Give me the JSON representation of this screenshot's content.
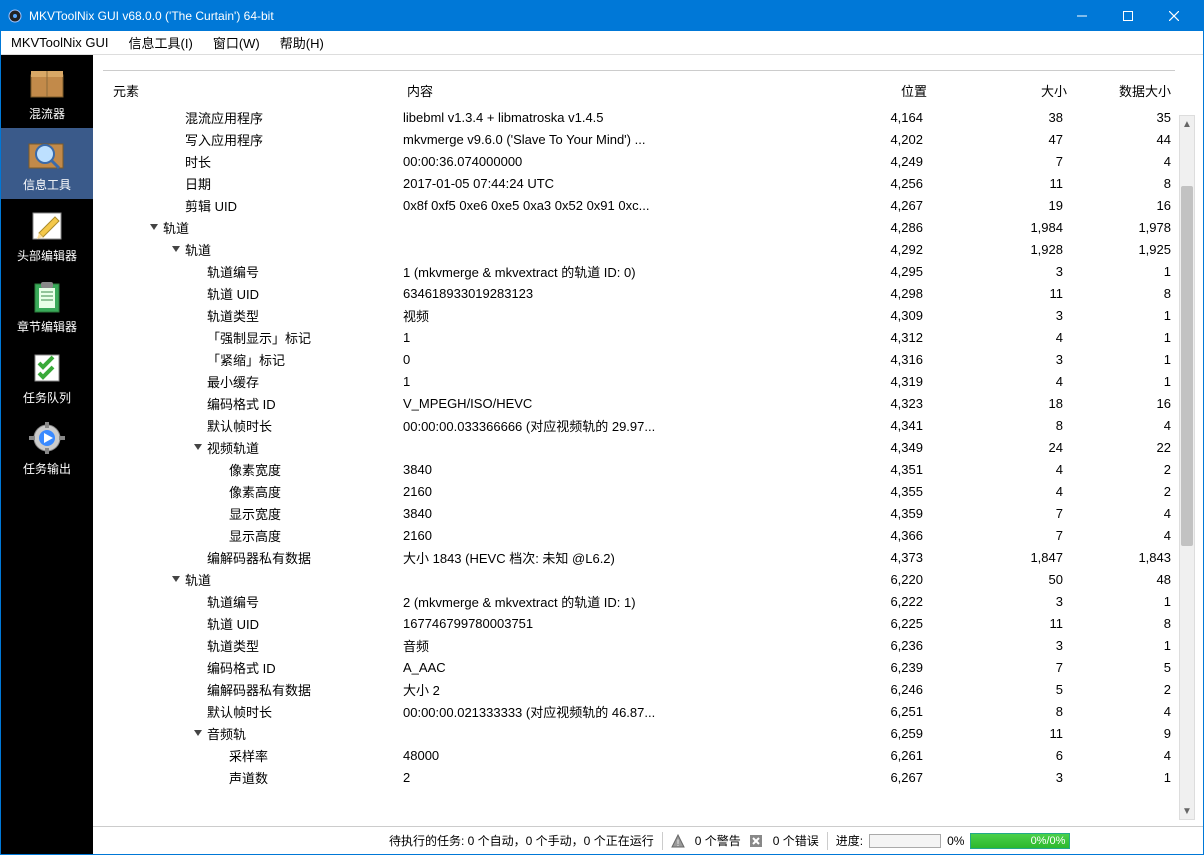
{
  "window": {
    "title": "MKVToolNix GUI v68.0.0 ('The Curtain') 64-bit"
  },
  "menubar": {
    "items": [
      "MKVToolNix GUI",
      "信息工具(I)",
      "窗口(W)",
      "帮助(H)"
    ]
  },
  "sidebar": {
    "items": [
      {
        "label": "混流器",
        "icon": "box"
      },
      {
        "label": "信息工具",
        "icon": "magnifier",
        "active": true
      },
      {
        "label": "头部编辑器",
        "icon": "pencil"
      },
      {
        "label": "章节编辑器",
        "icon": "clipboard"
      },
      {
        "label": "任务队列",
        "icon": "checklist"
      },
      {
        "label": "任务输出",
        "icon": "gearplay"
      }
    ]
  },
  "columns": {
    "c1": "元素",
    "c2": "内容",
    "c3": "位置",
    "c4": "大小",
    "c5": "数据大小"
  },
  "rows": [
    {
      "indent": 3,
      "exp": "",
      "c1": "混流应用程序",
      "c2": "libebml v1.3.4 + libmatroska v1.4.5",
      "c3": "4,164",
      "c4": "38",
      "c5": "35"
    },
    {
      "indent": 3,
      "exp": "",
      "c1": "写入应用程序",
      "c2": "mkvmerge v9.6.0 ('Slave To Your Mind') ...",
      "c3": "4,202",
      "c4": "47",
      "c5": "44"
    },
    {
      "indent": 3,
      "exp": "",
      "c1": "时长",
      "c2": "00:00:36.074000000",
      "c3": "4,249",
      "c4": "7",
      "c5": "4"
    },
    {
      "indent": 3,
      "exp": "",
      "c1": "日期",
      "c2": "2017-01-05 07:44:24 UTC",
      "c3": "4,256",
      "c4": "11",
      "c5": "8"
    },
    {
      "indent": 3,
      "exp": "",
      "c1": "剪辑 UID",
      "c2": "0x8f 0xf5 0xe6 0xe5 0xa3 0x52 0x91 0xc...",
      "c3": "4,267",
      "c4": "19",
      "c5": "16"
    },
    {
      "indent": 2,
      "exp": "open",
      "c1": "轨道",
      "c2": "",
      "c3": "4,286",
      "c4": "1,984",
      "c5": "1,978"
    },
    {
      "indent": 3,
      "exp": "open",
      "c1": "轨道",
      "c2": "",
      "c3": "4,292",
      "c4": "1,928",
      "c5": "1,925"
    },
    {
      "indent": 4,
      "exp": "",
      "c1": "轨道编号",
      "c2": "1 (mkvmerge & mkvextract 的轨道 ID: 0)",
      "c3": "4,295",
      "c4": "3",
      "c5": "1"
    },
    {
      "indent": 4,
      "exp": "",
      "c1": "轨道 UID",
      "c2": "634618933019283123",
      "c3": "4,298",
      "c4": "11",
      "c5": "8"
    },
    {
      "indent": 4,
      "exp": "",
      "c1": "轨道类型",
      "c2": "视频",
      "c3": "4,309",
      "c4": "3",
      "c5": "1"
    },
    {
      "indent": 4,
      "exp": "",
      "c1": "「强制显示」标记",
      "c2": "1",
      "c3": "4,312",
      "c4": "4",
      "c5": "1"
    },
    {
      "indent": 4,
      "exp": "",
      "c1": "「紧缩」标记",
      "c2": "0",
      "c3": "4,316",
      "c4": "3",
      "c5": "1"
    },
    {
      "indent": 4,
      "exp": "",
      "c1": "最小缓存",
      "c2": "1",
      "c3": "4,319",
      "c4": "4",
      "c5": "1"
    },
    {
      "indent": 4,
      "exp": "",
      "c1": "编码格式 ID",
      "c2": "V_MPEGH/ISO/HEVC",
      "c3": "4,323",
      "c4": "18",
      "c5": "16"
    },
    {
      "indent": 4,
      "exp": "",
      "c1": "默认帧时长",
      "c2": "00:00:00.033366666 (对应视频轨的 29.97...",
      "c3": "4,341",
      "c4": "8",
      "c5": "4"
    },
    {
      "indent": 4,
      "exp": "open",
      "c1": "视频轨道",
      "c2": "",
      "c3": "4,349",
      "c4": "24",
      "c5": "22"
    },
    {
      "indent": 5,
      "exp": "",
      "c1": "像素宽度",
      "c2": "3840",
      "c3": "4,351",
      "c4": "4",
      "c5": "2"
    },
    {
      "indent": 5,
      "exp": "",
      "c1": "像素高度",
      "c2": "2160",
      "c3": "4,355",
      "c4": "4",
      "c5": "2"
    },
    {
      "indent": 5,
      "exp": "",
      "c1": "显示宽度",
      "c2": "3840",
      "c3": "4,359",
      "c4": "7",
      "c5": "4"
    },
    {
      "indent": 5,
      "exp": "",
      "c1": "显示高度",
      "c2": "2160",
      "c3": "4,366",
      "c4": "7",
      "c5": "4"
    },
    {
      "indent": 4,
      "exp": "",
      "c1": "编解码器私有数据",
      "c2": "大小 1843 (HEVC 档次: 未知 @L6.2)",
      "c3": "4,373",
      "c4": "1,847",
      "c5": "1,843"
    },
    {
      "indent": 3,
      "exp": "open",
      "c1": "轨道",
      "c2": "",
      "c3": "6,220",
      "c4": "50",
      "c5": "48"
    },
    {
      "indent": 4,
      "exp": "",
      "c1": "轨道编号",
      "c2": "2 (mkvmerge & mkvextract 的轨道 ID: 1)",
      "c3": "6,222",
      "c4": "3",
      "c5": "1"
    },
    {
      "indent": 4,
      "exp": "",
      "c1": "轨道 UID",
      "c2": "167746799780003751",
      "c3": "6,225",
      "c4": "11",
      "c5": "8"
    },
    {
      "indent": 4,
      "exp": "",
      "c1": "轨道类型",
      "c2": "音频",
      "c3": "6,236",
      "c4": "3",
      "c5": "1"
    },
    {
      "indent": 4,
      "exp": "",
      "c1": "编码格式 ID",
      "c2": "A_AAC",
      "c3": "6,239",
      "c4": "7",
      "c5": "5"
    },
    {
      "indent": 4,
      "exp": "",
      "c1": "编解码器私有数据",
      "c2": "大小 2",
      "c3": "6,246",
      "c4": "5",
      "c5": "2"
    },
    {
      "indent": 4,
      "exp": "",
      "c1": "默认帧时长",
      "c2": "00:00:00.021333333 (对应视频轨的 46.87...",
      "c3": "6,251",
      "c4": "8",
      "c5": "4"
    },
    {
      "indent": 4,
      "exp": "open",
      "c1": "音频轨",
      "c2": "",
      "c3": "6,259",
      "c4": "11",
      "c5": "9"
    },
    {
      "indent": 5,
      "exp": "",
      "c1": "采样率",
      "c2": "48000",
      "c3": "6,261",
      "c4": "6",
      "c5": "4"
    },
    {
      "indent": 5,
      "exp": "",
      "c1": "声道数",
      "c2": "2",
      "c3": "6,267",
      "c4": "3",
      "c5": "1"
    }
  ],
  "statusbar": {
    "tasks": "待执行的任务: 0 个自动，0 个手动，0 个正在运行",
    "warnings": "0 个警告",
    "errors": "0 个错误",
    "progress_label": "进度:",
    "progress_pct": "0%",
    "progress_pct2": "0%/0%"
  }
}
